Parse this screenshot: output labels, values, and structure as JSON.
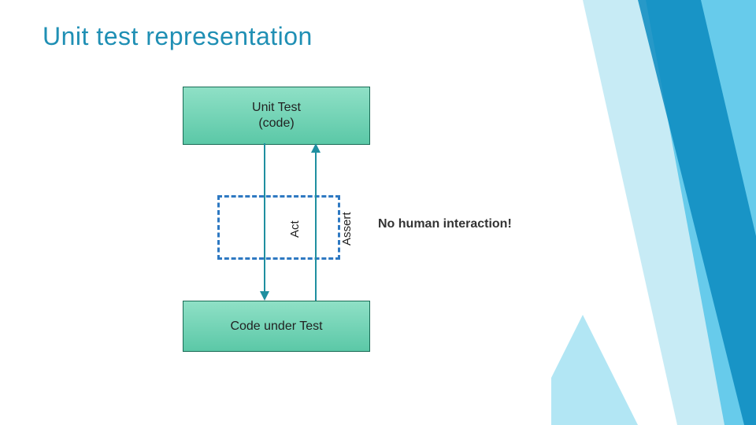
{
  "title": "Unit test representation",
  "box_top": {
    "line1": "Unit Test",
    "line2": "(code)"
  },
  "box_bottom": "Code under Test",
  "arrow_left_label": "Act",
  "arrow_right_label": "Assert",
  "callout": "No human interaction!",
  "colors": {
    "title": "#1f8fb4",
    "box_fill_top": "#8fe0c6",
    "box_fill_bottom": "#5bc8a7",
    "box_border": "#196b55",
    "dashed_border": "#2e79c2",
    "arrow": "#1f8fa0",
    "deco_light": "#b9e6f2",
    "deco_mid": "#4fc3e8",
    "deco_dark": "#0a8bbf"
  }
}
